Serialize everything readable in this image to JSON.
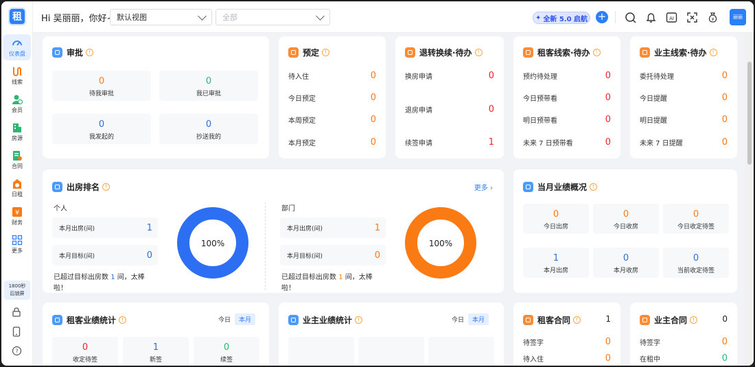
{
  "sidebar": {
    "logo": "租",
    "items": [
      {
        "label": "仪表盘",
        "icon": "gauge-icon"
      },
      {
        "label": "线索",
        "icon": "clue-icon"
      },
      {
        "label": "会员",
        "icon": "member-icon"
      },
      {
        "label": "房源",
        "icon": "building-icon"
      },
      {
        "label": "合同",
        "icon": "contract-icon"
      },
      {
        "label": "日租",
        "icon": "daily-rent-icon"
      },
      {
        "label": "财务",
        "icon": "finance-icon"
      },
      {
        "label": "更多",
        "icon": "grid-icon"
      }
    ],
    "lock_line1": "1800秒",
    "lock_line2": "后锁屏"
  },
  "header": {
    "greeting": "Hi 吴丽丽，你好~",
    "view_select": "默认视图",
    "scope_placeholder": "全部",
    "version_badge": "全新 5.0 启航",
    "add_label": "+",
    "avatar_text": "丽丽"
  },
  "approval": {
    "title": "审批",
    "items": [
      {
        "value": "0",
        "label": "待我审批"
      },
      {
        "value": "0",
        "label": "我已审批"
      },
      {
        "value": "0",
        "label": "我发起的"
      },
      {
        "value": "0",
        "label": "抄送我的"
      }
    ]
  },
  "booking": {
    "title": "预定",
    "rows": [
      {
        "label": "待入住",
        "value": "0"
      },
      {
        "label": "今日预定",
        "value": "0"
      },
      {
        "label": "本周预定",
        "value": "0"
      },
      {
        "label": "本月预定",
        "value": "0"
      }
    ]
  },
  "checkout": {
    "title": "退转换续·待办",
    "rows": [
      {
        "label": "换房申请",
        "value": "0"
      },
      {
        "label": "退房申请",
        "value": "0"
      },
      {
        "label": "续签申请",
        "value": "1"
      }
    ]
  },
  "tenant_leads": {
    "title": "租客线索·待办",
    "rows": [
      {
        "label": "预约待处理",
        "value": "0"
      },
      {
        "label": "今日预带看",
        "value": "0"
      },
      {
        "label": "明日预带看",
        "value": "0"
      },
      {
        "label": "未来 7 日预带看",
        "value": "0"
      }
    ]
  },
  "owner_leads": {
    "title": "业主线索·待办",
    "rows": [
      {
        "label": "委托待处理",
        "value": "0"
      },
      {
        "label": "今日提醒",
        "value": "0"
      },
      {
        "label": "明日提醒",
        "value": "0"
      },
      {
        "label": "未来 7 日提醒",
        "value": "0"
      }
    ]
  },
  "ranking": {
    "title": "出房排名",
    "more": "更多",
    "personal": {
      "heading": "个人",
      "actual_label": "本月出房(间)",
      "actual_value": "1",
      "target_label": "本月目标(间)",
      "target_value": "0",
      "note_a": "已超过目标出房数 ",
      "note_num": "1",
      "note_b": " 间，太棒啦！",
      "percent": "100%",
      "fill": 1.0,
      "color": "#2d6ff2"
    },
    "department": {
      "heading": "部门",
      "actual_label": "本月出房(间)",
      "actual_value": "1",
      "target_label": "本月目标(间)",
      "target_value": "0",
      "note_a": "已超过目标出房数 ",
      "note_num": "1",
      "note_b": " 间，太棒啦！",
      "percent": "100%",
      "fill": 1.0,
      "color": "#fa7a14"
    }
  },
  "monthly": {
    "title": "当月业绩概况",
    "items": [
      {
        "value": "0",
        "label": "今日出房"
      },
      {
        "value": "0",
        "label": "今日收房"
      },
      {
        "value": "0",
        "label": "今日收定待签"
      },
      {
        "value": "1",
        "label": "本月出房"
      },
      {
        "value": "0",
        "label": "本月收房"
      },
      {
        "value": "0",
        "label": "当前收定待签"
      }
    ]
  },
  "tenant_stats": {
    "title": "租客业绩统计",
    "tab_today": "今日",
    "tab_month": "本月",
    "items": [
      {
        "value": "0",
        "label": "收定待签"
      },
      {
        "value": "1",
        "label": "新签"
      },
      {
        "value": "0",
        "label": "续签"
      }
    ]
  },
  "owner_stats": {
    "title": "业主业绩统计",
    "tab_today": "今日",
    "tab_month": "本月"
  },
  "tenant_contract": {
    "title": "租客合同",
    "count": "1",
    "rows": [
      {
        "label": "待签字",
        "value": "0"
      },
      {
        "label": "待入住",
        "value": "0"
      }
    ]
  },
  "owner_contract": {
    "title": "业主合同",
    "count": "0",
    "rows": [
      {
        "label": "待签字",
        "value": "0"
      },
      {
        "label": "在租中",
        "value": "0"
      }
    ]
  }
}
